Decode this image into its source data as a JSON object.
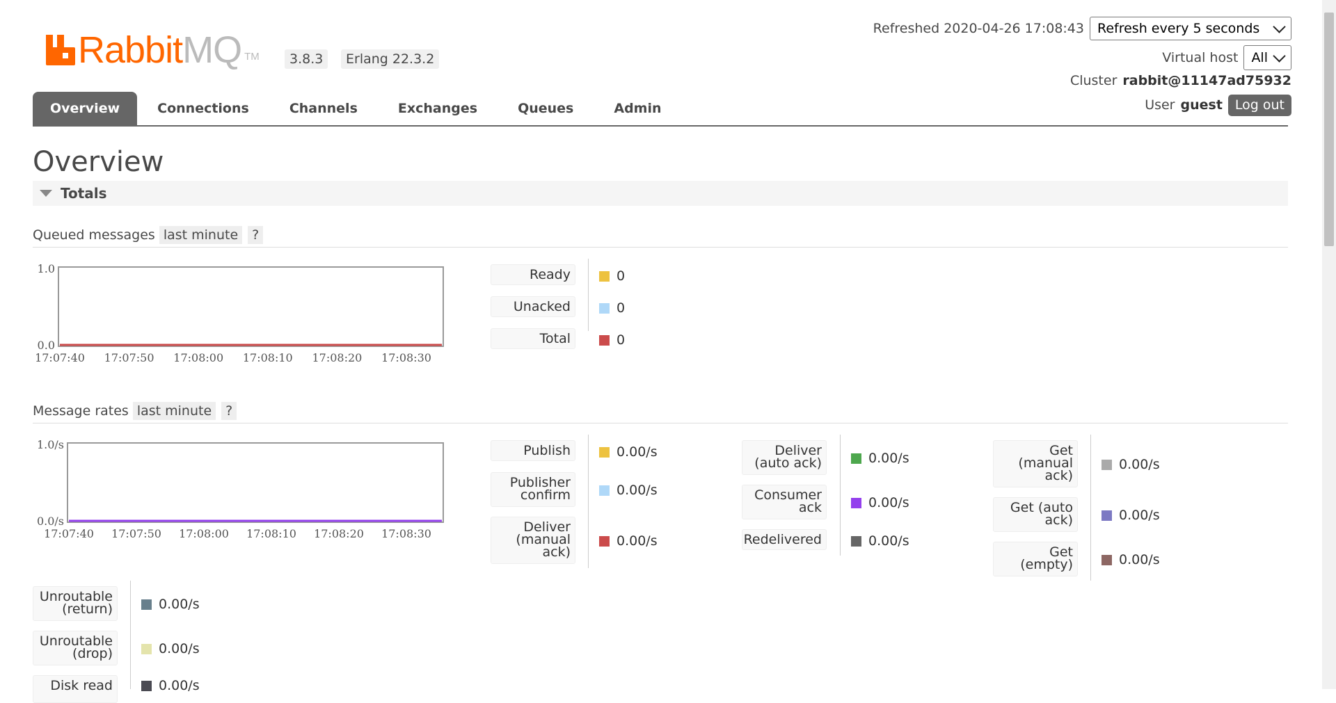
{
  "header": {
    "brand_rabbit": "Rabbit",
    "brand_mq": "MQ",
    "brand_tm": "TM",
    "version": "3.8.3",
    "erlang": "Erlang 22.3.2",
    "refreshed_label": "Refreshed 2020-04-26 17:08:43",
    "refresh_select": "Refresh every 5 seconds",
    "vhost_label": "Virtual host",
    "vhost_select": "All",
    "cluster_label": "Cluster",
    "cluster_name": "rabbit@11147ad75932",
    "user_label": "User",
    "user_name": "guest",
    "logout": "Log out"
  },
  "tabs": [
    {
      "label": "Overview",
      "active": true
    },
    {
      "label": "Connections"
    },
    {
      "label": "Channels"
    },
    {
      "label": "Exchanges"
    },
    {
      "label": "Queues"
    },
    {
      "label": "Admin"
    }
  ],
  "page_title": "Overview",
  "section": {
    "title": "Totals"
  },
  "queued": {
    "heading": "Queued messages",
    "range": "last minute",
    "help": "?",
    "legend": [
      {
        "label": "Ready",
        "value": "0",
        "color": "#edc240"
      },
      {
        "label": "Unacked",
        "value": "0",
        "color": "#afd8f8"
      },
      {
        "label": "Total",
        "value": "0",
        "color": "#cb4b4b"
      }
    ]
  },
  "rates": {
    "heading": "Message rates",
    "range": "last minute",
    "help": "?",
    "col1": [
      {
        "label": "Publish",
        "value": "0.00/s",
        "color": "#edc240"
      },
      {
        "label": "Publisher confirm",
        "value": "0.00/s",
        "color": "#afd8f8"
      },
      {
        "label": "Deliver (manual ack)",
        "value": "0.00/s",
        "color": "#cb4b4b"
      }
    ],
    "col2": [
      {
        "label": "Deliver (auto ack)",
        "value": "0.00/s",
        "color": "#4da74d"
      },
      {
        "label": "Consumer ack",
        "value": "0.00/s",
        "color": "#9440ed"
      },
      {
        "label": "Redelivered",
        "value": "0.00/s",
        "color": "#666666"
      }
    ],
    "col3": [
      {
        "label": "Get (manual ack)",
        "value": "0.00/s",
        "color": "#aaaaaa"
      },
      {
        "label": "Get (auto ack)",
        "value": "0.00/s",
        "color": "#7c79c3"
      },
      {
        "label": "Get (empty)",
        "value": "0.00/s",
        "color": "#8d6763"
      }
    ],
    "col4": [
      {
        "label": "Unroutable (return)",
        "value": "0.00/s",
        "color": "#687f8c"
      },
      {
        "label": "Unroutable (drop)",
        "value": "0.00/s",
        "color": "#e4e4ac"
      },
      {
        "label": "Disk read",
        "value": "0.00/s",
        "color": "#4a4a52"
      }
    ]
  },
  "chart_data": [
    {
      "type": "line",
      "ylim": [
        0,
        1
      ],
      "y_ticks": [
        "1.0",
        "0.0"
      ],
      "x_ticks": [
        "17:07:40",
        "17:07:50",
        "17:08:00",
        "17:08:10",
        "17:08:20",
        "17:08:30"
      ],
      "series": [
        {
          "name": "Ready",
          "color": "#edc240",
          "values": [
            0,
            0,
            0,
            0,
            0,
            0
          ]
        },
        {
          "name": "Unacked",
          "color": "#afd8f8",
          "values": [
            0,
            0,
            0,
            0,
            0,
            0
          ]
        },
        {
          "name": "Total",
          "color": "#cb4b4b",
          "values": [
            0,
            0,
            0,
            0,
            0,
            0
          ]
        }
      ]
    },
    {
      "type": "line",
      "ylim": [
        0,
        1
      ],
      "y_ticks": [
        "1.0/s",
        "0.0/s"
      ],
      "x_ticks": [
        "17:07:40",
        "17:07:50",
        "17:08:00",
        "17:08:10",
        "17:08:20",
        "17:08:30"
      ],
      "series": [
        {
          "name": "Publish",
          "color": "#edc240",
          "values": [
            0,
            0,
            0,
            0,
            0,
            0
          ]
        },
        {
          "name": "Consumer ack",
          "color": "#9440ed",
          "values": [
            0,
            0,
            0,
            0,
            0,
            0
          ]
        }
      ]
    }
  ]
}
